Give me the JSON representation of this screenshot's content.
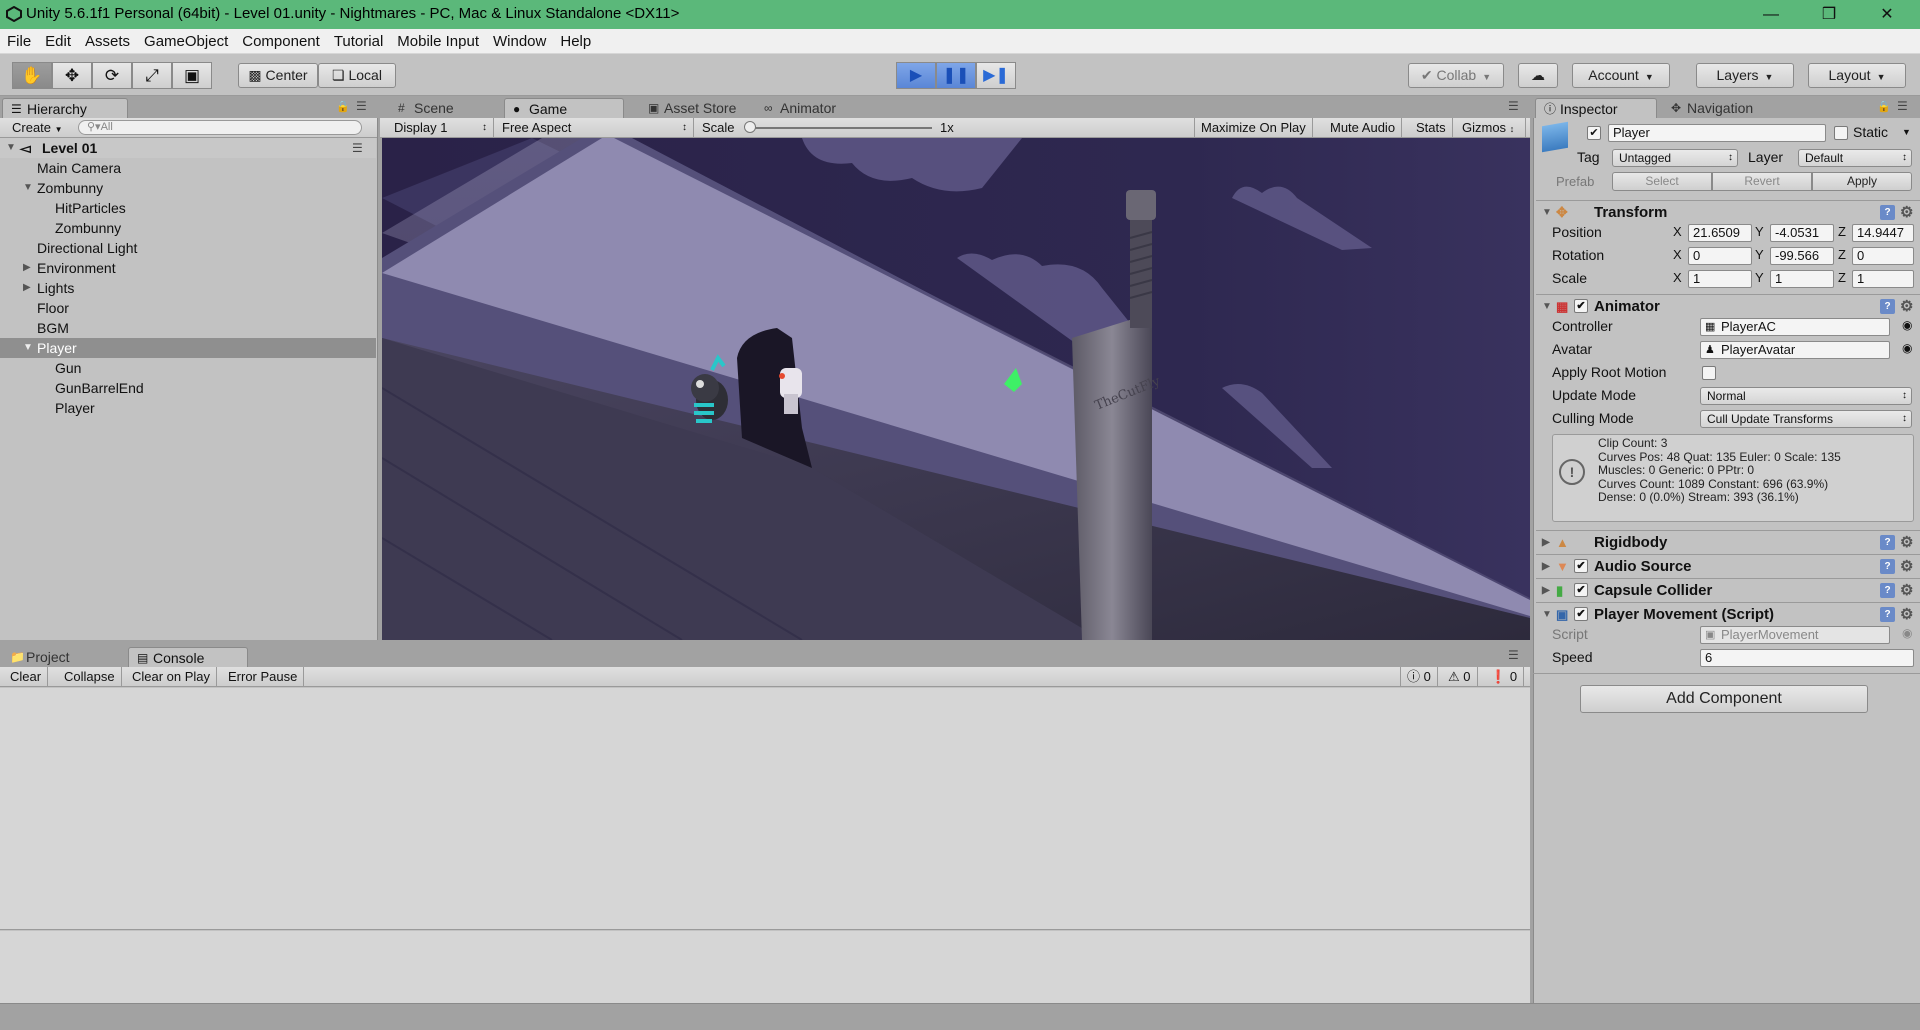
{
  "window": {
    "title": "Unity 5.6.1f1 Personal (64bit) - Level 01.unity - Nightmares - PC, Mac & Linux Standalone <DX11>",
    "min": "—",
    "max": "❒",
    "close": "✕"
  },
  "menu": [
    "File",
    "Edit",
    "Assets",
    "GameObject",
    "Component",
    "Tutorial",
    "Mobile Input",
    "Window",
    "Help"
  ],
  "toolbar": {
    "center": "Center",
    "local": "Local",
    "collab": "Collab",
    "account": "Account",
    "layers": "Layers",
    "layout": "Layout"
  },
  "hierarchy": {
    "tab": "Hierarchy",
    "create": "Create",
    "search_placeholder": "All",
    "scene": "Level 01",
    "items": [
      "Main Camera",
      "Zombunny",
      "HitParticles",
      "Zombunny",
      "Directional Light",
      "Environment",
      "Lights",
      "Floor",
      "BGM",
      "Player",
      "Gun",
      "GunBarrelEnd",
      "Player"
    ]
  },
  "scene_tabs": {
    "scene": "Scene",
    "game": "Game",
    "asset_store": "Asset Store",
    "animator": "Animator"
  },
  "game_bar": {
    "display": "Display 1",
    "aspect": "Free Aspect",
    "scale_label": "Scale",
    "scale_value": "1x",
    "maximize": "Maximize On Play",
    "mute": "Mute Audio",
    "stats": "Stats",
    "gizmos": "Gizmos"
  },
  "bottom": {
    "project": "Project",
    "console": "Console",
    "clear": "Clear",
    "collapse": "Collapse",
    "clear_on_play": "Clear on Play",
    "error_pause": "Error Pause",
    "count_info": "0",
    "count_warn": "0",
    "count_error": "0"
  },
  "inspector": {
    "tab": "Inspector",
    "nav_tab": "Navigation",
    "name": "Player",
    "static": "Static",
    "tag_label": "Tag",
    "tag": "Untagged",
    "layer_label": "Layer",
    "layer": "Default",
    "prefab": "Prefab",
    "select": "Select",
    "revert": "Revert",
    "apply": "Apply",
    "transform": {
      "title": "Transform",
      "position": "Position",
      "rotation": "Rotation",
      "scale": "Scale",
      "px": "21.6509",
      "py": "-4.0531",
      "pz": "14.9447",
      "rx": "0",
      "ry": "-99.566",
      "rz": "0",
      "sx": "1",
      "sy": "1",
      "sz": "1"
    },
    "animator": {
      "title": "Animator",
      "controller_label": "Controller",
      "controller": "PlayerAC",
      "avatar_label": "Avatar",
      "avatar": "PlayerAvatar",
      "apply_root": "Apply Root Motion",
      "update_label": "Update Mode",
      "update": "Normal",
      "culling_label": "Culling Mode",
      "culling": "Cull Update Transforms",
      "info": [
        "Clip Count: 3",
        "Curves Pos: 48 Quat: 135 Euler: 0 Scale: 135",
        "Muscles: 0 Generic: 0 PPtr: 0",
        "Curves Count: 1089 Constant: 696 (63.9%)",
        "Dense: 0 (0.0%) Stream: 393 (36.1%)"
      ]
    },
    "rigidbody": "Rigidbody",
    "audio": "Audio Source",
    "capsule": "Capsule Collider",
    "movement": {
      "title": "Player Movement (Script)",
      "script_label": "Script",
      "script": "PlayerMovement",
      "speed_label": "Speed",
      "speed": "6"
    },
    "add_component": "Add Component"
  },
  "game_text": {
    "bat_brand": "TheCutFly"
  },
  "colors": {
    "title_bg": "#5bb87a",
    "panel": "#c2c2c2",
    "selection": "#8f8f8f",
    "play_active": "#5a86d6",
    "game_bg": "#2a2448"
  }
}
